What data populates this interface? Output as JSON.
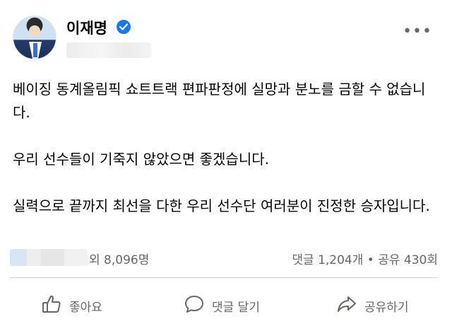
{
  "author": {
    "name": "이재명"
  },
  "post": {
    "paragraphs": [
      "베이징 동계올림픽 쇼트트랙 편파판정에 실망과 분노를 금할 수 없습니다.",
      "우리 선수들이 기죽지 않았으면 좋겠습니다.",
      "실력으로 끝까지 최선을 다한 우리 선수단 여러분이 진정한 승자입니다."
    ]
  },
  "stats": {
    "reactions_text": "외 8,096명",
    "comments_shares_text": "댓글 1,204개 • 공유 430회"
  },
  "actions": {
    "like_label": "좋아요",
    "comment_label": "댓글 달기",
    "share_label": "공유하기"
  },
  "icons": {
    "verified": "verified-badge-icon",
    "more": "more-options-icon",
    "like": "thumbs-up-icon",
    "comment": "comment-bubble-icon",
    "share": "share-arrow-icon"
  },
  "colors": {
    "verified_badge": "#1877f2",
    "secondary_text": "#65676b",
    "primary_text": "#050505"
  }
}
